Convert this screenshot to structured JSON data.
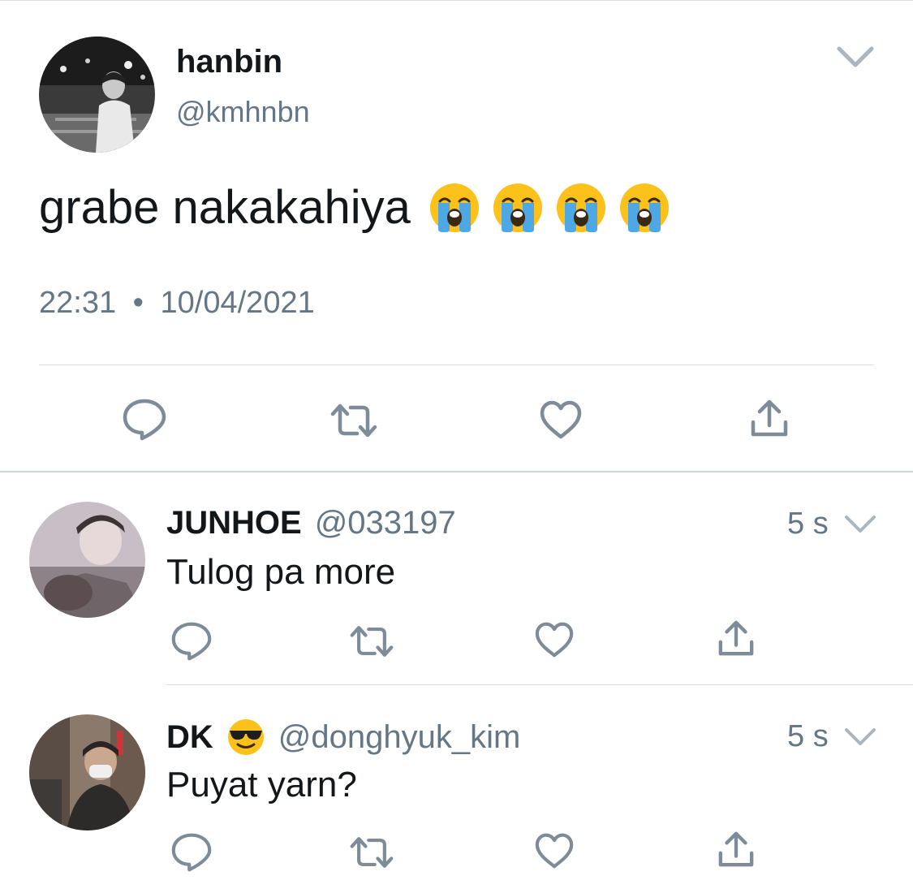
{
  "tweet": {
    "author_name": "hanbin",
    "author_handle": "@kmhnbn",
    "text": "grabe nakakahiya",
    "emojis": [
      "loudly-crying-face",
      "loudly-crying-face",
      "loudly-crying-face",
      "loudly-crying-face"
    ],
    "time": "22:31",
    "separator": "•",
    "date": "10/04/2021",
    "actions": [
      "reply-icon",
      "retweet-icon",
      "like-icon",
      "share-icon"
    ]
  },
  "replies": [
    {
      "name": "JUNHOE",
      "handle": "@033197",
      "time": "5 s",
      "text": "Tulog pa more",
      "name_emoji": ""
    },
    {
      "name": "DK",
      "handle": "@donghyuk_kim",
      "time": "5 s",
      "text": "Puyat yarn?",
      "name_emoji": "smiling-face-with-sunglasses"
    }
  ],
  "colors": {
    "text": "#14171a",
    "secondary": "#657786",
    "icon": "#7d8c98",
    "divider": "#d9dde1"
  }
}
